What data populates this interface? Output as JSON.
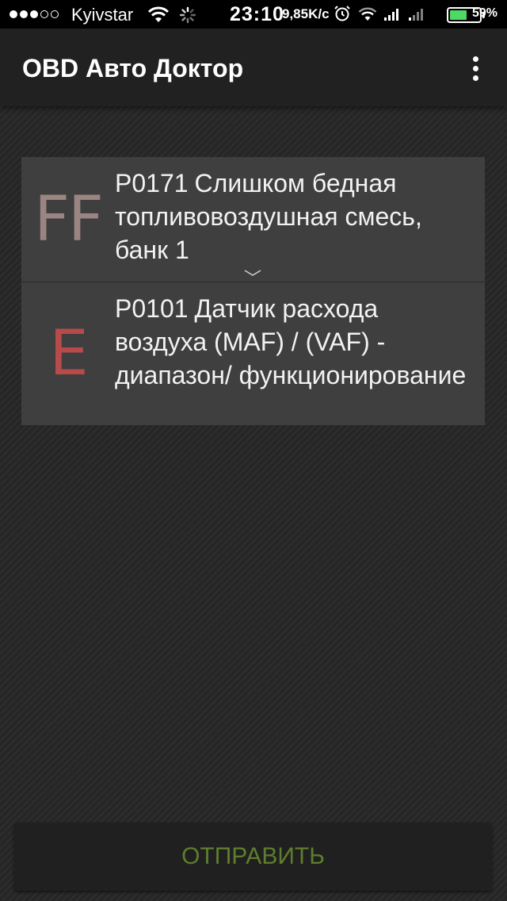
{
  "status_bar": {
    "carrier": "Kyivstar",
    "time": "23:10",
    "network_speed": "9,85K/c",
    "battery_percent": "59%",
    "battery_level": 0.59,
    "signal_dots_filled": 3,
    "signal_dots_total": 5,
    "battery_color": "#4cd964"
  },
  "app_bar": {
    "title": "OBD Авто Доктор",
    "menu_icon": "more-vert-icon"
  },
  "codes": [
    {
      "badge": "FF",
      "badge_color": "#9a8582",
      "code": "P0171",
      "description": "Слишком бедная топливовоздушная смесь, банк 1",
      "expand_icon": "chevron-down-icon"
    },
    {
      "badge": "E",
      "badge_color": "#b84a4a",
      "code": "P0101",
      "description": "Датчик расхода воздуха (MAF) / (VAF) - диапазон/ функционирование"
    }
  ],
  "send_button": {
    "label": "ОТПРАВИТЬ",
    "color": "#5f7d2e"
  }
}
